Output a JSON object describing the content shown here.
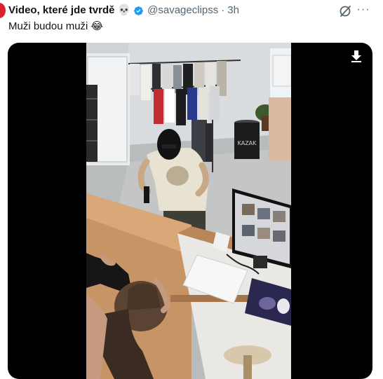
{
  "tweet": {
    "display_name": "Video, které jde tvrdě",
    "name_emoji": "💀",
    "handle": "@savageclipss",
    "separator": "·",
    "time": "3h",
    "more_label": "···",
    "text": "Muži budou muži 😂"
  },
  "icons": {
    "verified": "verified-badge-icon",
    "grok": "grok-icon",
    "more": "more-options-icon",
    "download": "download-icon"
  },
  "scene": {
    "bin_label": "KAZAK"
  },
  "colors": {
    "verified": "#1d9bf0",
    "text_primary": "#0f1419",
    "text_secondary": "#536471",
    "avatar": "#d8232a"
  }
}
